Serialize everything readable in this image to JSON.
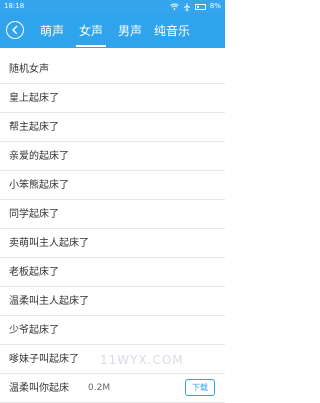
{
  "status_bar": {
    "time": "18:18",
    "battery": "8%"
  },
  "tabs": [
    {
      "label": "萌声",
      "active": false
    },
    {
      "label": "女声",
      "active": true
    },
    {
      "label": "男声",
      "active": false
    },
    {
      "label": "纯音乐",
      "active": false
    }
  ],
  "items": [
    "随机女声",
    "皇上起床了",
    "帮主起床了",
    "亲爱的起床了",
    "小笨熊起床了",
    "同学起床了",
    "卖萌叫主人起床了",
    "老板起床了",
    "温柔叫主人起床了",
    "少爷起床了",
    "嗲妹子叫起床了",
    "温柔叫你起床"
  ],
  "last_item": {
    "size": "0.2M",
    "download_label": "下载"
  },
  "watermark": "11WYX.COM",
  "colors": {
    "accent": "#2fa4ec",
    "status_bar": "#35a5ee"
  }
}
